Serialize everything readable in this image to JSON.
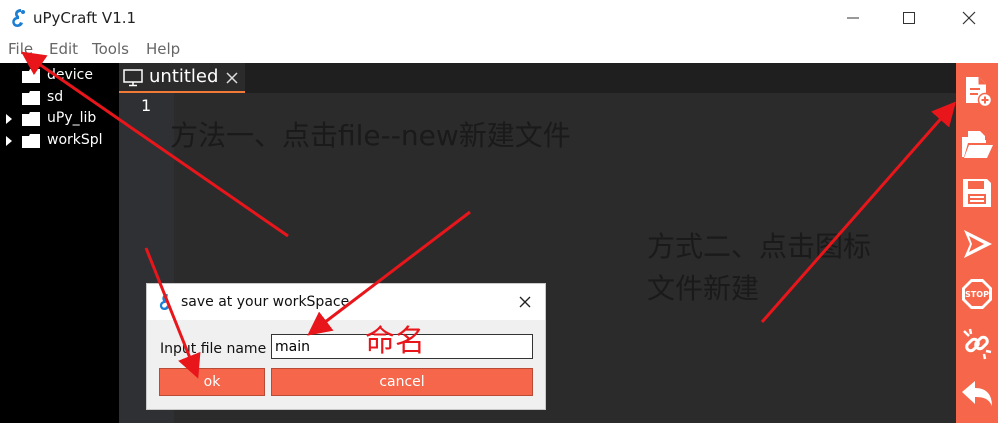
{
  "window": {
    "title": "uPyCraft V1.1",
    "minimize_icon": "minimize-icon",
    "maximize_icon": "maximize-icon",
    "close_icon": "close-icon"
  },
  "menu": {
    "items": [
      "File",
      "Edit",
      "Tools",
      "Help"
    ]
  },
  "sidebar": {
    "items": [
      {
        "label": "device",
        "expandable": false
      },
      {
        "label": "sd",
        "expandable": false
      },
      {
        "label": "uPy_lib",
        "expandable": true
      },
      {
        "label": "workSpl",
        "expandable": true
      }
    ]
  },
  "editor": {
    "tab_label": "untitled",
    "line_number": "1"
  },
  "toolbar": {
    "icons": [
      "new-file-icon",
      "open-folder-icon",
      "save-icon",
      "run-icon",
      "stop-icon",
      "connect-icon",
      "undo-icon"
    ],
    "stop_text": "STOP"
  },
  "annotations": {
    "method1": "方法一、点击file--new新建文件",
    "method2_line1": "方式二、点击图标",
    "method2_line2": "文件新建",
    "naming": "命名"
  },
  "dialog": {
    "title": "save at your workSpace",
    "label": "Input file name",
    "value": "main",
    "ok_label": "ok",
    "cancel_label": "cancel"
  },
  "colors": {
    "accent": "#f5664a",
    "sidebar_bg": "#000000",
    "editor_bg": "#2b2b2b",
    "annotation_red": "#e8161b",
    "tab_underline": "#f07a36"
  }
}
